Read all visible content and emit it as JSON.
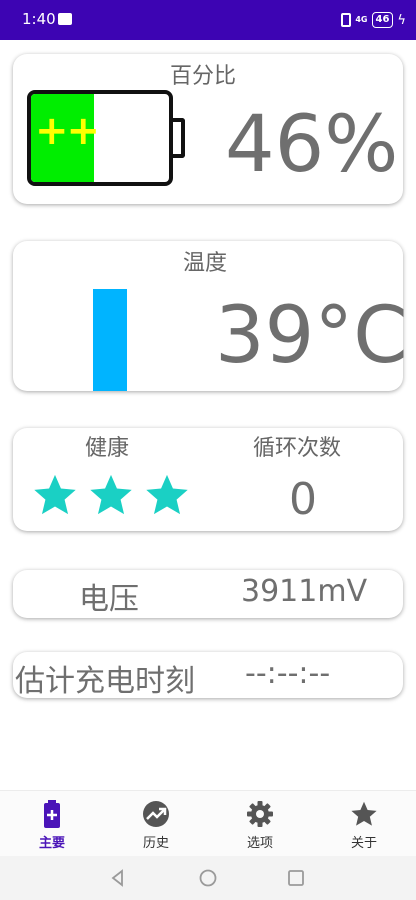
{
  "status_bar": {
    "time": "1:40",
    "network": "4G",
    "battery": "46",
    "icons": [
      "message-icon",
      "vibrate-icon",
      "signal-icon",
      "battery-icon",
      "charging-icon"
    ]
  },
  "percent_card": {
    "title": "百分比",
    "value": "46%",
    "level": 0.46,
    "battery_symbol": "++"
  },
  "temperature_card": {
    "title": "温度",
    "value": "39°C",
    "level": 0.88
  },
  "health_card": {
    "health_title": "健康",
    "stars": 3,
    "cycles_title": "循环次数",
    "cycles_value": "0"
  },
  "voltage_row": {
    "label": "电压",
    "value": "3911mV"
  },
  "estimate_row": {
    "label": "估计充电时刻",
    "value": "--:--:--"
  },
  "nav": {
    "items": [
      {
        "label": "主要",
        "icon": "battery-icon",
        "active": true
      },
      {
        "label": "历史",
        "icon": "trending-icon",
        "active": false
      },
      {
        "label": "选项",
        "icon": "gear-icon",
        "active": false
      },
      {
        "label": "关于",
        "icon": "star-icon",
        "active": false
      }
    ]
  },
  "colors": {
    "status_bar": "#3d04b3",
    "battery_fill": "#00ee00",
    "battery_plus": "#ffff00",
    "temp_bar": "#00b4ff",
    "stars": "#1ad0c4",
    "nav_active": "#4a14b8"
  }
}
